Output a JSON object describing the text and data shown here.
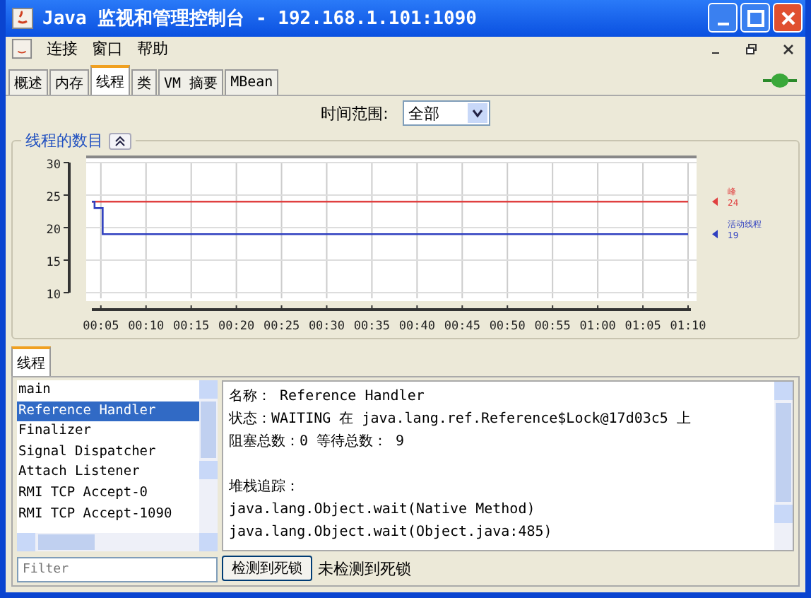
{
  "window": {
    "title": "Java 监视和管理控制台 - 192.168.1.101:1090"
  },
  "menu": [
    "连接",
    "窗口",
    "帮助"
  ],
  "tabs": [
    {
      "label": "概述",
      "selected": false
    },
    {
      "label": "内存",
      "selected": false
    },
    {
      "label": "线程",
      "selected": true
    },
    {
      "label": "类",
      "selected": false
    },
    {
      "label": "VM 摘要",
      "selected": false
    },
    {
      "label": "MBean",
      "selected": false
    }
  ],
  "time_range": {
    "label": "时间范围:",
    "value": "全部"
  },
  "chart_panel": {
    "title": "线程的数目",
    "legend_values": [
      "24",
      "19"
    ],
    "chart_data": {
      "type": "line",
      "grid": true,
      "x": [
        4,
        4.3,
        5.1,
        5.2,
        70
      ],
      "ylim": [
        10,
        30
      ],
      "yticks": [
        10,
        15,
        20,
        25,
        30
      ],
      "xlim": [
        4,
        70
      ],
      "xticks": [
        {
          "value": 5,
          "label": "00:05"
        },
        {
          "value": 10,
          "label": "00:10"
        },
        {
          "value": 15,
          "label": "00:15"
        },
        {
          "value": 20,
          "label": "00:20"
        },
        {
          "value": 25,
          "label": "00:25"
        },
        {
          "value": 30,
          "label": "00:30"
        },
        {
          "value": 35,
          "label": "00:35"
        },
        {
          "value": 40,
          "label": "00:40"
        },
        {
          "value": 45,
          "label": "00:45"
        },
        {
          "value": 50,
          "label": "00:50"
        },
        {
          "value": 55,
          "label": "00:55"
        },
        {
          "value": 60,
          "label": "01:00"
        },
        {
          "value": 65,
          "label": "01:05"
        },
        {
          "value": 70,
          "label": "01:10"
        }
      ],
      "series": [
        {
          "name": "峰",
          "color": "#e04040",
          "values": [
            24,
            24,
            24,
            24,
            24
          ]
        },
        {
          "name": "活动线程",
          "color": "#3040c0",
          "values": [
            24,
            23,
            23,
            19,
            19
          ]
        }
      ]
    }
  },
  "threads_tab": {
    "label": "线程",
    "selected": true
  },
  "threads": [
    {
      "name": "main",
      "selected": false
    },
    {
      "name": "Reference Handler",
      "selected": true
    },
    {
      "name": "Finalizer",
      "selected": false
    },
    {
      "name": "Signal Dispatcher",
      "selected": false
    },
    {
      "name": "Attach Listener",
      "selected": false
    },
    {
      "name": "RMI TCP Accept-0",
      "selected": false
    },
    {
      "name": "RMI TCP Accept-1090",
      "selected": false
    }
  ],
  "details": [
    "名称： Reference Handler",
    "状态：WAITING 在 java.lang.ref.Reference$Lock@17d03c5 上",
    "阻塞总数：0  等待总数： 9"
  ],
  "stack_trace": {
    "label": "堆栈追踪：",
    "lines": [
      "java.lang.Object.wait(Native Method)",
      "java.lang.Object.wait(Object.java:485)"
    ]
  },
  "filter": {
    "placeholder": "Filter"
  },
  "deadlock_button": "检测到死锁",
  "deadlock_status": "未检测到死锁"
}
